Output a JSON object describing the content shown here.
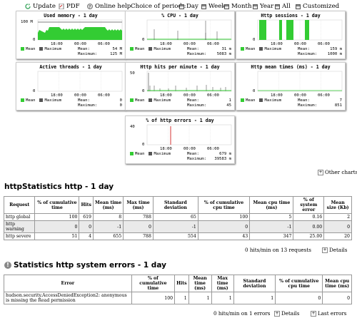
{
  "toolbar": {
    "update": "Update",
    "pdf": "PDF",
    "online_help": "Online help",
    "choice_label": "Choice of period :",
    "periods": [
      "Day",
      "Week",
      "Month",
      "Year",
      "All",
      "Customized"
    ]
  },
  "charts": [
    {
      "title": "Used memory - 1 day",
      "ymax": "100 M",
      "ymin": "0",
      "xticks": [
        "18:00",
        "00:00",
        "06:00"
      ],
      "mean_label": "Mean",
      "max_label": "Maximum",
      "mean_k": "Mean:",
      "mean_v": "54 M",
      "max_k": "Maximum:",
      "max_v": "125 M",
      "kind": "memory"
    },
    {
      "title": "% CPU - 1 day",
      "ymax": "",
      "ymin": "0",
      "xticks": [
        "18:00",
        "00:00",
        "06:00"
      ],
      "mean_label": "Mean",
      "max_label": "Maximum",
      "mean_k": "Mean:",
      "mean_v": "31 m",
      "max_k": "Maximum:",
      "max_v": "5083 m",
      "kind": "cpu"
    },
    {
      "title": "Http sessions - 1 day",
      "ymax": "",
      "ymin": "0",
      "xticks": [
        "18:00",
        "00:00",
        "06:00"
      ],
      "mean_label": "Mean",
      "max_label": "Maximum",
      "mean_k": "Mean:",
      "mean_v": "159 m",
      "max_k": "Maximum:",
      "max_v": "1000 m",
      "kind": "sessions"
    },
    {
      "title": "Active threads - 1 day",
      "ymax": "",
      "ymin": "0",
      "xticks": [
        "18:00",
        "00:00",
        "06:00"
      ],
      "mean_label": "Mean",
      "max_label": "Maximum",
      "mean_k": "Mean:",
      "mean_v": "0",
      "max_k": "Maximum:",
      "max_v": "0",
      "kind": "empty"
    },
    {
      "title": "Http hits per minute - 1 day",
      "ymax": "50",
      "ymin": "0",
      "xticks": [
        "18:00",
        "00:00",
        "06:00"
      ],
      "mean_label": "Mean",
      "max_label": "Maximum",
      "mean_k": "Mean:",
      "mean_v": "1",
      "max_k": "Maximum:",
      "max_v": "45",
      "kind": "hits"
    },
    {
      "title": "Http mean times (ms) - 1 day",
      "ymax": "",
      "ymin": "0",
      "xticks": [
        "18:00",
        "00:00",
        "06:00"
      ],
      "mean_label": "Mean",
      "max_label": "Maximum",
      "mean_k": "Mean:",
      "mean_v": "7",
      "max_k": "Maximum:",
      "max_v": "851",
      "kind": "times"
    },
    {
      "title": "% of http errors - 1 day",
      "ymax": "40",
      "ymin": "0",
      "xticks": [
        "18:00",
        "00:00",
        "06:00"
      ],
      "mean_label": "Mean",
      "max_label": "Maximum",
      "mean_k": "Mean:",
      "mean_v": "679 m",
      "max_k": "Maximum:",
      "max_v": "39583 m",
      "kind": "errors"
    }
  ],
  "other_charts": "Other charts",
  "http_stats": {
    "title": "httpStatistics http - 1 day",
    "headers": [
      "Request",
      "% of cumulative time",
      "Hits",
      "Mean time (ms)",
      "Max time (ms)",
      "Standard deviation",
      "% of cumulative cpu time",
      "Mean cpu time (ms)",
      "% of system error",
      "Mean size (Kb)"
    ],
    "rows": [
      [
        "http global",
        "100",
        "619",
        "8",
        "788",
        "65",
        "100",
        "5",
        "0.16",
        "2"
      ],
      [
        "http warning",
        "0",
        "0",
        "-1",
        "0",
        "-1",
        "0",
        "-1",
        "0.00",
        "0"
      ],
      [
        "http severe",
        "51",
        "4",
        "655",
        "788",
        "554",
        "43",
        "347",
        "25.00",
        "20"
      ]
    ],
    "footer": "0 hits/min on 13 requests",
    "details": "Details"
  },
  "sys_errors": {
    "title": "Statistics http system errors - 1 day",
    "headers": [
      "Error",
      "% of cumulative time",
      "Hits",
      "Mean time (ms)",
      "Max time (ms)",
      "Standard deviation",
      "% of cumulative cpu time",
      "Mean cpu time (ms)"
    ],
    "rows": [
      [
        "hudson.security.AccessDeniedException2: anonymous is missing the Read permission",
        "100",
        "1",
        "1",
        "1",
        "1",
        "0",
        "0"
      ]
    ],
    "footer": "0 hits/min on 1 errors",
    "details": "Details",
    "last_errors": "Last errors"
  },
  "colors": {
    "green": "#33cc33",
    "dark": "#555555",
    "red_tick": "#cc0000"
  }
}
